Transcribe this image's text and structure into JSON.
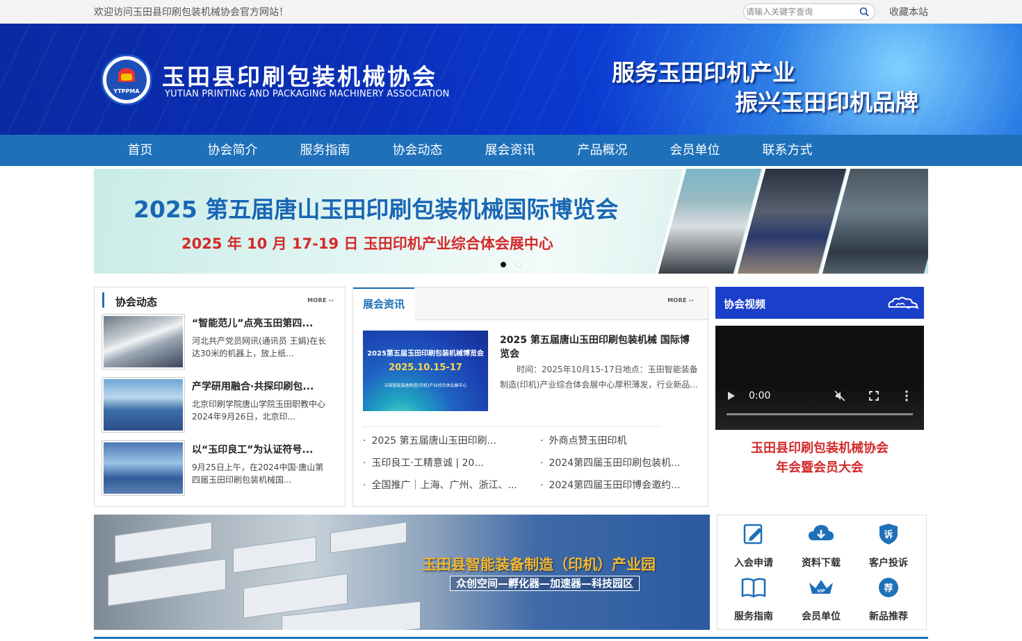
{
  "topbar": {
    "welcome": "欢迎访问玉田县印刷包装机械协会官方网站！",
    "search_placeholder": "请输入关键字查询",
    "favorite": "收藏本站"
  },
  "header": {
    "logo_cn": "玉田县印刷包装机械协会",
    "logo_en": "YUTIAN PRINTING AND PACKAGING MACHINERY ASSOCIATION",
    "logo_abbr": "YTPPMA",
    "slogan_line1": "服务玉田印机产业",
    "slogan_line2": "振兴玉田印机品牌"
  },
  "nav": [
    "首页",
    "协会简介",
    "服务指南",
    "协会动态",
    "展会资讯",
    "产品概况",
    "会员单位",
    "联系方式"
  ],
  "hero": {
    "title": "2025 第五届唐山玉田印刷包装机械国际博览会",
    "subtitle": "2025 年 10 月 17-19 日   玉田印机产业综合体会展中心",
    "slide_count": 2,
    "active_slide": 1
  },
  "news": {
    "title": "协会动态",
    "more": "MORE",
    "items": [
      {
        "title": "“智能范儿”点亮玉田第四...",
        "desc": "河北共产党员网讯(通讯员 王娟)在长达30米的机器上，放上纸..."
      },
      {
        "title": "产学研用融合·共探印刷包...",
        "desc": "北京印刷学院唐山学院玉田职教中心2024年9月26日，北京印..."
      },
      {
        "title": "以“玉印良工”为认证符号...",
        "desc": "9月25日上午，在2024中国·唐山第四届玉田印刷包装机械国..."
      }
    ]
  },
  "expo": {
    "tab": "展会资讯",
    "more": "MORE",
    "feature_image": {
      "line1": "2025第五届玉田印刷包装机械博览会",
      "line2": "2025.10.15-17",
      "line3": "玉田智能装备制造(印机)产业综合体会展中心"
    },
    "feature_title": "2025 第五届唐山玉田印刷包装机械 国际博览会",
    "feature_desc": "时间：2025年10月15-17日地点：玉田智能装备制造(印机)产业综合体会展中心厚积薄发，行业新品...",
    "links": [
      "2025 第五届唐山玉田印刷...",
      "外商点赞玉田印机",
      "玉印良工·工精意诚 | 20...",
      "2024第四届玉田印刷包装机...",
      "全国推广｜上海、广州、浙江、...",
      "2024第四届玉田印博会邀约..."
    ]
  },
  "video": {
    "title": "协会视频",
    "time": "0:00",
    "caption_line1": "玉田县印刷包装机械协会",
    "caption_line2": "年会暨会员大会"
  },
  "park": {
    "title": "玉田县智能装备制造（印机）产业园",
    "subtitle": "众创空间—孵化器—加速器—科技园区"
  },
  "quick_links": [
    {
      "label": "入会申请",
      "icon": "edit-icon"
    },
    {
      "label": "资料下载",
      "icon": "cloud-download-icon"
    },
    {
      "label": "客户投诉",
      "icon": "complaint-shield-icon",
      "glyph": "诉"
    },
    {
      "label": "服务指南",
      "icon": "book-icon"
    },
    {
      "label": "会员单位",
      "icon": "vip-crown-icon",
      "glyph": "VIP"
    },
    {
      "label": "新品推荐",
      "icon": "recommend-icon",
      "glyph": "荐"
    }
  ],
  "colors": {
    "nav": "#1e70b9",
    "header": "#0b3ad1",
    "accent_red": "#d42a2a",
    "video_header": "#1a3fc8"
  }
}
